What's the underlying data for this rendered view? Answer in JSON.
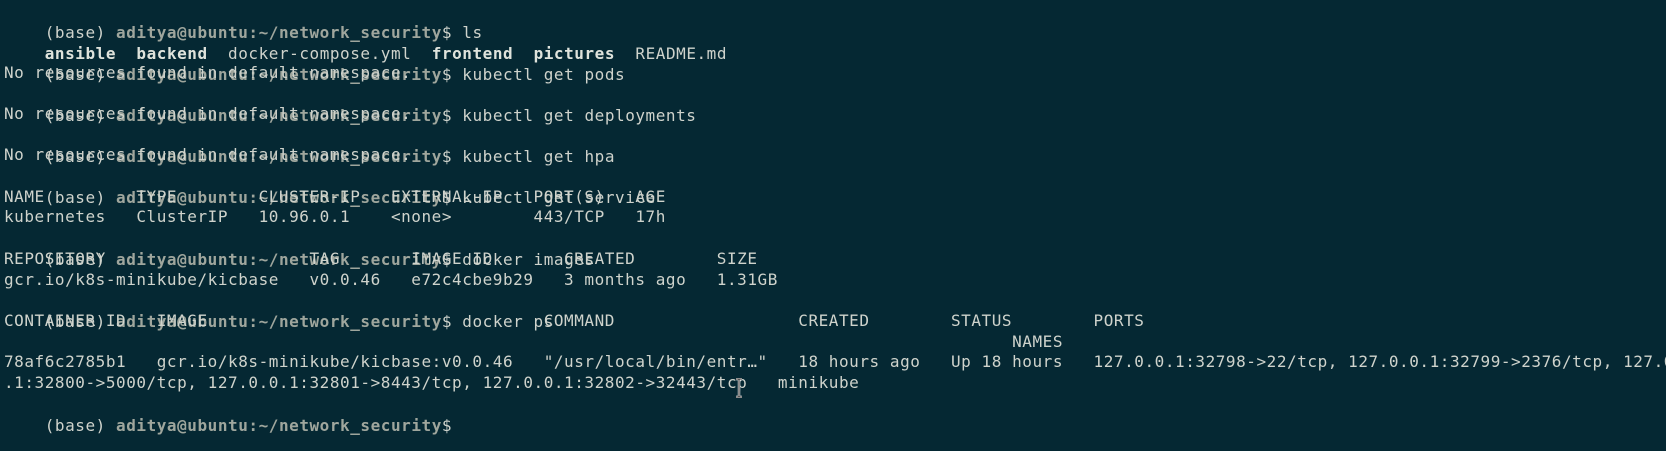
{
  "prompt": {
    "env": "(base) ",
    "user_host": "aditya@ubuntu",
    "path": ":~/network_security",
    "dollar": "$ "
  },
  "commands": {
    "ls": "ls",
    "get_pods": "kubectl get pods",
    "get_deployments": "kubectl get deployments",
    "get_hpa": "kubectl get hpa",
    "get_service": "kubectl get service",
    "docker_images": "docker images",
    "docker_ps": "docker ps"
  },
  "ls_output": {
    "ansible": "ansible",
    "backend": "backend",
    "docker_compose": "docker-compose.yml",
    "frontend": "frontend",
    "pictures": "pictures",
    "readme": "README.md"
  },
  "messages": {
    "no_resources": "No resources found in default namespace."
  },
  "service_table": {
    "header": "NAME         TYPE        CLUSTER-IP   EXTERNAL-IP   PORT(S)   AGE",
    "rows": [
      "kubernetes   ClusterIP   10.96.0.1    <none>        443/TCP   17h"
    ]
  },
  "images_table": {
    "header": "REPOSITORY                    TAG       IMAGE ID       CREATED        SIZE",
    "rows": [
      "gcr.io/k8s-minikube/kicbase   v0.0.46   e72c4cbe9b29   3 months ago   1.31GB"
    ]
  },
  "ps_table": {
    "header": "CONTAINER ID   IMAGE                                 COMMAND                  CREATED        STATUS        PORTS",
    "header_names": "                                                                                                   NAMES",
    "row_line1": "78af6c2785b1   gcr.io/k8s-minikube/kicbase:v0.0.46   \"/usr/local/bin/entr…\"   18 hours ago   Up 18 hours   127.0.0.1:32798->22/tcp, 127.0.0.1:32799->2376/tcp, 127.0.0",
    "row_line2": ".1:32800->5000/tcp, 127.0.0.1:32801->8443/tcp, 127.0.0.1:32802->32443/tcp   minikube"
  },
  "colors": {
    "background": "#052833",
    "text": "#cfd3cc",
    "prompt_bold": "#9fa69d",
    "dir_bold": "#dfe3dc"
  }
}
